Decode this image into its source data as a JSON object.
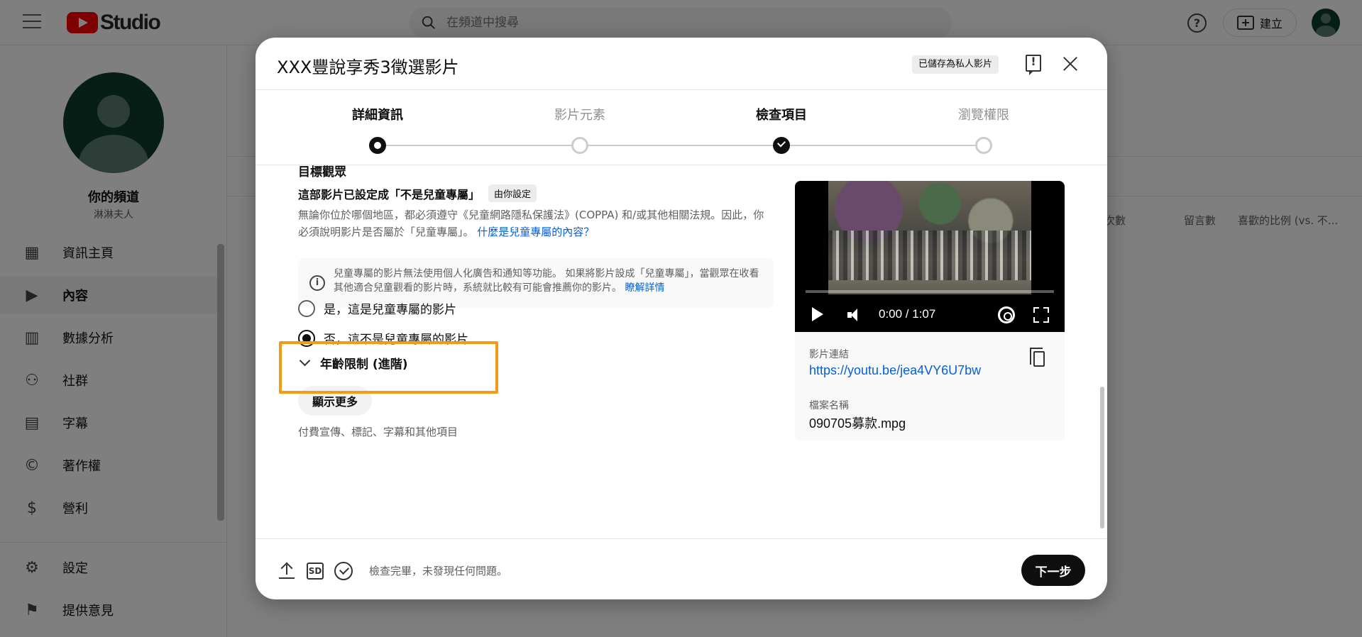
{
  "app": {
    "logo_text": "Studio",
    "search_placeholder": "在頻道中搜尋",
    "create_label": "建立",
    "help_label": "?"
  },
  "sidebar": {
    "channel_title": "你的頻道",
    "channel_subtitle": "淋淋夫人",
    "items": [
      {
        "label": "資訊主頁",
        "icon": "dashboard-icon"
      },
      {
        "label": "內容",
        "icon": "content-icon",
        "active": true
      },
      {
        "label": "數據分析",
        "icon": "analytics-icon"
      },
      {
        "label": "社群",
        "icon": "community-icon"
      },
      {
        "label": "字幕",
        "icon": "subtitles-icon"
      },
      {
        "label": "著作權",
        "icon": "copyright-icon"
      },
      {
        "label": "營利",
        "icon": "monetization-icon"
      }
    ],
    "bottom_items": [
      {
        "label": "設定",
        "icon": "gear-icon"
      },
      {
        "label": "提供意見",
        "icon": "feedback-icon"
      }
    ]
  },
  "background_table": {
    "columns": [
      "次數",
      "留言數",
      "喜歡的比例 (vs. 不..."
    ]
  },
  "dialog": {
    "title": "XXX豐說享秀3徵選影片",
    "saved_badge": "已儲存為私人影片",
    "steps": [
      {
        "label": "詳細資訊",
        "state": "current"
      },
      {
        "label": "影片元素",
        "state": "todo"
      },
      {
        "label": "檢查項目",
        "state": "done"
      },
      {
        "label": "瀏覽權限",
        "state": "todo"
      }
    ],
    "audience": {
      "heading": "目標觀眾",
      "set_as": "這部影片已設定成「不是兒童專屬」",
      "set_by": "由你設定",
      "description": "無論你位於哪個地區，都必須遵守《兒童網路隱私保護法》(COPPA) 和/或其他相關法規。因此，你必須說明影片是否屬於「兒童專屬」。",
      "description_link": "什麼是兒童專屬的內容？",
      "info_text": "兒童專屬的影片無法使用個人化廣告和通知等功能。 如果將影片設成「兒童專屬」，當觀眾在收看其他適合兒童觀看的影片時，系統就比較有可能會推薦你的影片。",
      "info_link": "瞭解詳情",
      "option_yes": "是，這是兒童專屬的影片",
      "option_no": "否，這不是兒童專屬的影片",
      "age_restriction": "年齡限制 (進階)",
      "show_more": "顯示更多",
      "show_more_sub": "付費宣傳、標記、字幕和其他項目"
    },
    "preview": {
      "time": "0:00 / 1:07",
      "link_label": "影片連結",
      "link": "https://youtu.be/jea4VY6U7bw",
      "filename_label": "檔案名稱",
      "filename": "090705募款.mpg"
    },
    "footer": {
      "status": "檢查完畢，未發現任何問題。",
      "sd_label": "SD",
      "next": "下一步"
    }
  },
  "colors": {
    "accent_link": "#065fd4",
    "highlight": "#f39c12",
    "brand_red": "#ff0000"
  }
}
